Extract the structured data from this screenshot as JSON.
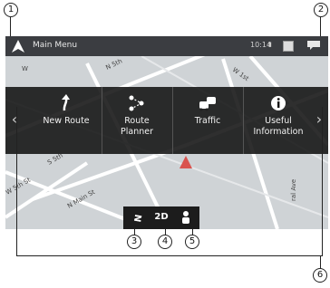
{
  "callouts": {
    "c1": "1",
    "c2": "2",
    "c3": "3",
    "c4": "4",
    "c5": "5",
    "c6": "6"
  },
  "titlebar": {
    "title": "Main Menu",
    "time": "10:14",
    "status_icons": [
      "signal-icon",
      "battery-icon",
      "message-icon"
    ]
  },
  "menu": {
    "items": [
      {
        "label": "New Route",
        "icon": "new-route-icon"
      },
      {
        "label": "Route\nPlanner",
        "icon": "route-planner-icon"
      },
      {
        "label": "Traffic",
        "icon": "traffic-icon"
      },
      {
        "label": "Useful\nInformation",
        "icon": "info-icon"
      }
    ],
    "left_arrow": "‹",
    "right_arrow": "›"
  },
  "bottom_bar": {
    "view_mode": "2D",
    "compass_icon": "compass-icon",
    "person_icon": "person-icon"
  },
  "map_labels": [
    "N 5th",
    "W",
    "S 5th",
    "W 5th St",
    "N Main St",
    "ral Ave",
    "W 1st"
  ],
  "colors": {
    "titlebar": "#3b3d41",
    "menubar": "#121212",
    "map": "#cfd3d6",
    "road": "#ffffff",
    "position_marker": "#d9534f"
  }
}
